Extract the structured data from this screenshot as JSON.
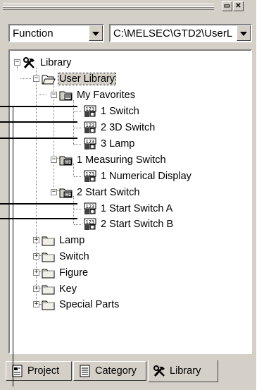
{
  "window": {
    "minimize_glyph": "▭",
    "close_glyph": "✕"
  },
  "toolbar": {
    "mode_select": {
      "value": "Function"
    },
    "path_select": {
      "value": "C:\\MELSEC\\GTD2\\UserL"
    }
  },
  "tree": {
    "root": "Library",
    "user_library": "User Library",
    "my_favorites": "My Favorites",
    "fav_items": [
      "1 Switch",
      "2 3D Switch",
      "3 Lamp"
    ],
    "measuring_switch": "1 Measuring Switch",
    "measuring_items": [
      "1 Numerical Display"
    ],
    "start_switch": "2 Start Switch",
    "start_items": [
      "1 Start Switch A",
      "2 Start Switch B"
    ],
    "folders": [
      "Lamp",
      "Switch",
      "Figure",
      "Key",
      "Special Parts"
    ]
  },
  "tabs": [
    "Project",
    "Category",
    "Library"
  ],
  "active_tab": "Library",
  "icons": {
    "root": "hammer-wrench-icon",
    "folder": "folder-icon",
    "favorites": "favorites-folder-icon",
    "object": "numeric-object-icon"
  },
  "colors": {
    "panel": "#d4d0c8",
    "selection": "#d4d0c8",
    "tree_bg": "#ffffff"
  }
}
